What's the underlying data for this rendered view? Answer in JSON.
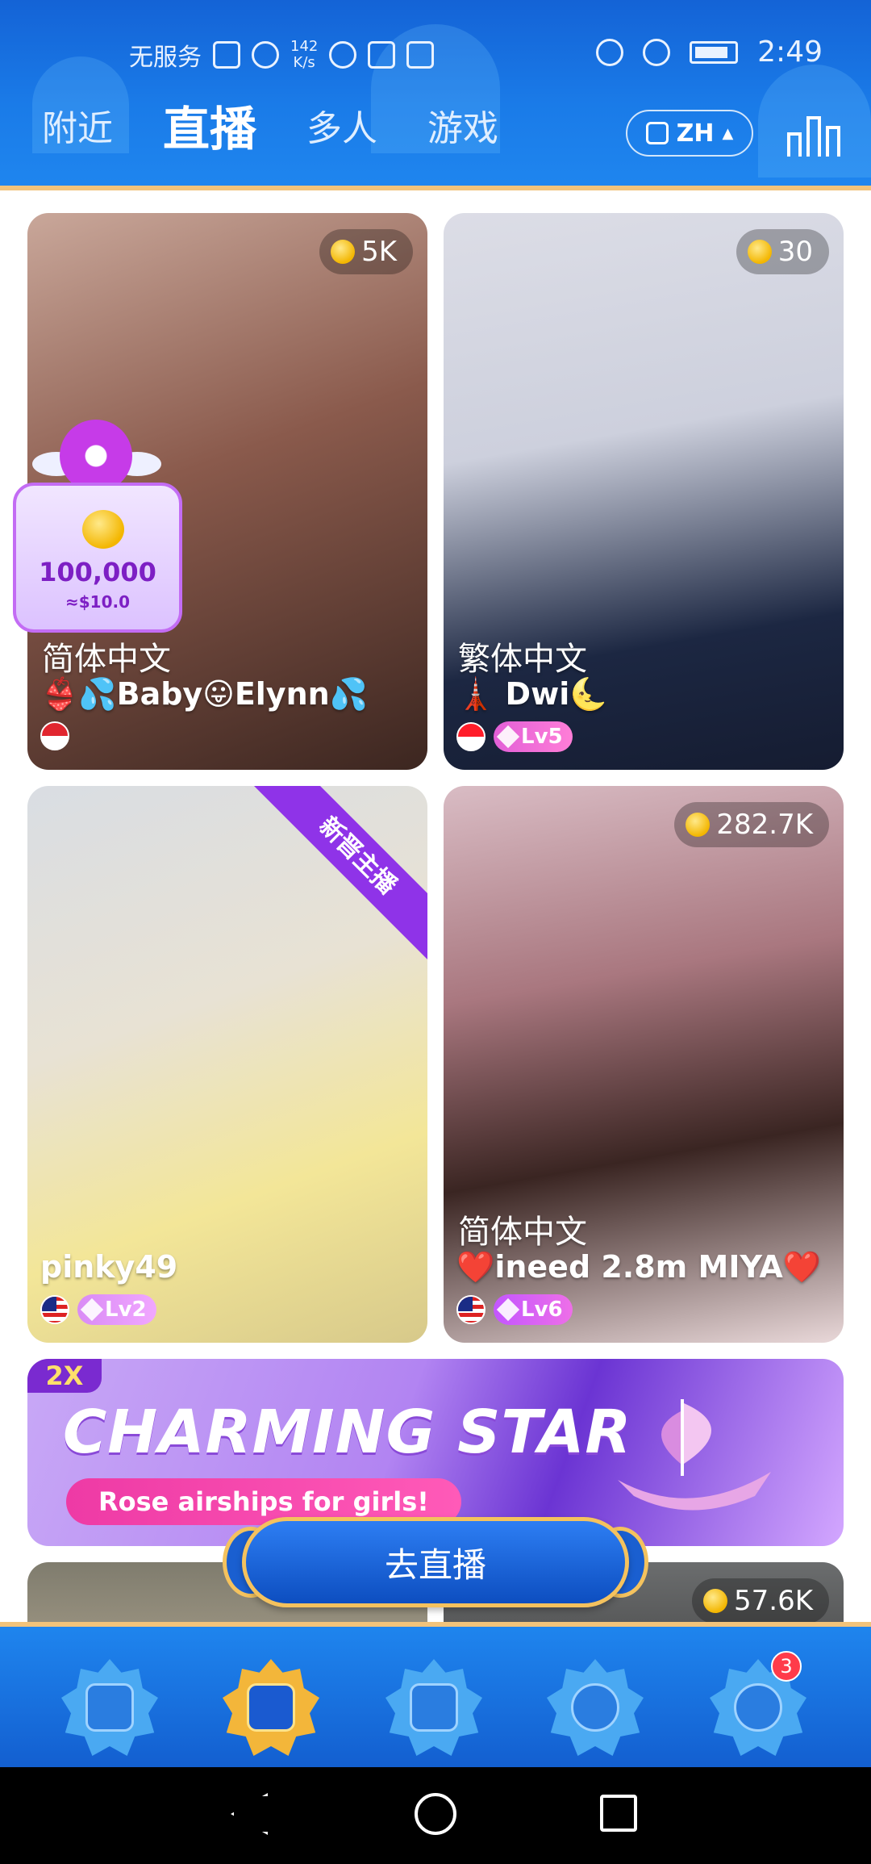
{
  "status_bar": {
    "carrier": "无服务",
    "speed": "142\nK/s",
    "time": "2:49"
  },
  "tabs": [
    {
      "label": "附近",
      "active": false
    },
    {
      "label": "直播",
      "active": true
    },
    {
      "label": "多人",
      "active": false
    },
    {
      "label": "游戏",
      "active": false
    }
  ],
  "language_button": {
    "label": "ZH"
  },
  "cards": [
    {
      "coins": "5K",
      "language": "简体中文",
      "name": "👙💦Baby😛Elynn💦",
      "flag": "sg",
      "level": ""
    },
    {
      "coins": "30",
      "language": "繁体中文",
      "name": "🗼 Dwi🌜",
      "flag": "id",
      "level": "Lv5"
    },
    {
      "coins": "",
      "language": "",
      "name": "pinky49",
      "flag": "my",
      "level": "Lv2",
      "ribbon": "新晋主播"
    },
    {
      "coins": "282.7K",
      "language": "简体中文",
      "name": "❤️ineed 2.8m  MIYA❤️",
      "flag": "my",
      "level": "Lv6"
    },
    {
      "coins": ""
    },
    {
      "coins": "57.6K"
    }
  ],
  "reward": {
    "amount": "100,000",
    "usd": "≈$10.0"
  },
  "banner": {
    "badge": "2X",
    "title": "CHARMING STAR",
    "subtitle": "Rose airships for girls!"
  },
  "go_live": {
    "label": "去直播"
  },
  "bottom_nav": {
    "items": [
      {
        "name": "discover-tab",
        "active": false
      },
      {
        "name": "live-tab",
        "active": true
      },
      {
        "name": "friends-tab",
        "active": false
      },
      {
        "name": "planet-tab",
        "active": false
      },
      {
        "name": "profile-tab",
        "active": false,
        "badge": "3"
      }
    ]
  },
  "colors": {
    "header_blue": "#1a7be8",
    "gold_accent": "#f2c37a",
    "level_pink": "#e25fd7",
    "ribbon_purple": "#8f33e8"
  }
}
